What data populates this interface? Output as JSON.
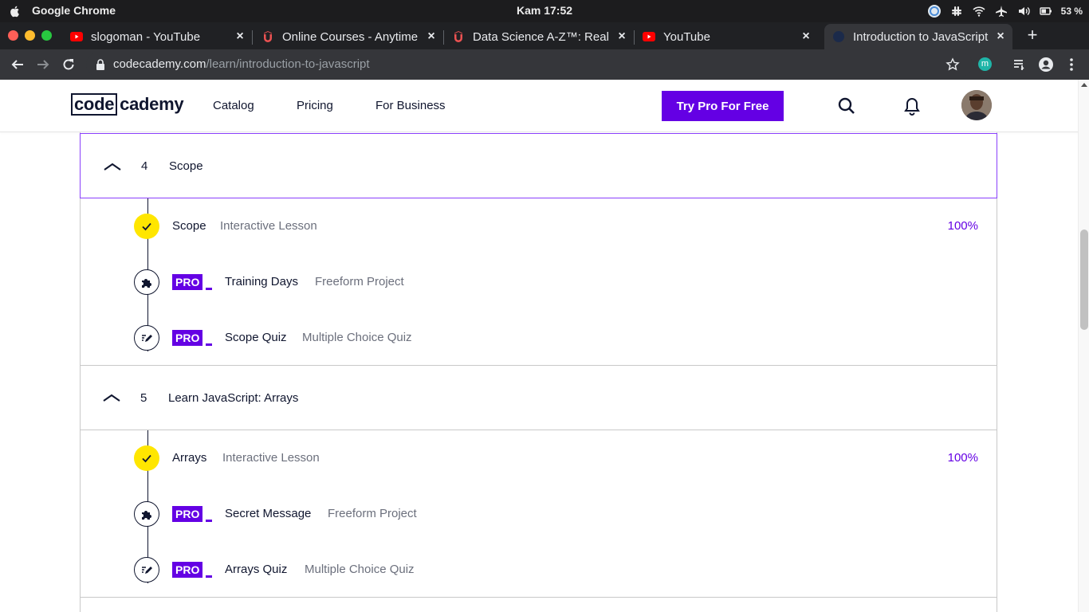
{
  "os": {
    "app_name": "Google Chrome",
    "clock": "Kam 17:52",
    "battery": "53 %"
  },
  "browser": {
    "tabs": [
      {
        "title": "slogoman - YouTube",
        "favicon": "youtube-icon"
      },
      {
        "title": "Online Courses - Anytime",
        "favicon": "udemy-icon"
      },
      {
        "title": "Data Science A-Z™: Real",
        "favicon": "udemy-icon"
      },
      {
        "title": "YouTube",
        "favicon": "youtube-icon"
      },
      {
        "title": "Introduction to JavaScript",
        "favicon": "codecademy-icon"
      }
    ],
    "active_tab": 4,
    "url_host": "codecademy.com",
    "url_path": "/learn/introduction-to-javascript",
    "extension_badge": "m"
  },
  "header": {
    "logo_code": "code",
    "logo_academy": "cademy",
    "nav": [
      "Catalog",
      "Pricing",
      "For Business"
    ],
    "cta": "Try Pro For Free"
  },
  "modules": [
    {
      "number": "4",
      "title": "Scope",
      "items": [
        {
          "name": "Scope",
          "type": "Interactive Lesson",
          "status": "done",
          "progress": "100%",
          "pro": false
        },
        {
          "name": "Training Days",
          "type": "Freeform Project",
          "status": "locked",
          "pro": true,
          "icon": "puzzle-icon"
        },
        {
          "name": "Scope Quiz",
          "type": "Multiple Choice Quiz",
          "status": "locked",
          "pro": true,
          "icon": "quiz-pencil-icon"
        }
      ]
    },
    {
      "number": "5",
      "title": "Learn JavaScript: Arrays",
      "items": [
        {
          "name": "Arrays",
          "type": "Interactive Lesson",
          "status": "done",
          "progress": "100%",
          "pro": false
        },
        {
          "name": "Secret Message",
          "type": "Freeform Project",
          "status": "locked",
          "pro": true,
          "icon": "puzzle-icon"
        },
        {
          "name": "Arrays Quiz",
          "type": "Multiple Choice Quiz",
          "status": "locked",
          "pro": true,
          "icon": "quiz-pencil-icon"
        }
      ]
    }
  ],
  "pro_badge": "PRO",
  "colors": {
    "brand_purple": "#6400e4",
    "complete_yellow": "#ffe600",
    "navy": "#10162f"
  }
}
